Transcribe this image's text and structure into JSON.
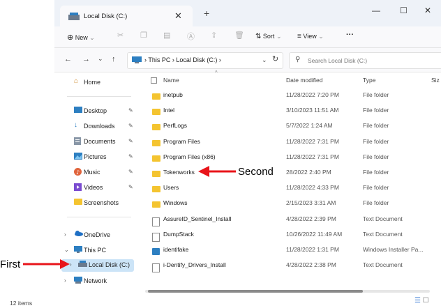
{
  "window": {
    "tab_title": "Local Disk (C:)",
    "tab_close": "✕",
    "new_tab": "+",
    "minimize": "—",
    "maximize": "☐",
    "close": "✕"
  },
  "toolbar": {
    "new_label": "New",
    "sort_label": "Sort",
    "view_label": "View",
    "more_label": "···"
  },
  "address": {
    "breadcrumb": "›  This PC  ›  Local Disk (C:)  ›",
    "search_placeholder": "Search Local Disk (C:)"
  },
  "nav_pane": {
    "home": "Home",
    "desktop": "Desktop",
    "downloads": "Downloads",
    "documents": "Documents",
    "pictures": "Pictures",
    "music": "Music",
    "videos": "Videos",
    "screenshots": "Screenshots",
    "onedrive": "OneDrive",
    "this_pc": "This PC",
    "local_disk": "Local Disk (C:)",
    "network": "Network"
  },
  "columns": {
    "name": "Name",
    "date": "Date modified",
    "type": "Type",
    "size": "Siz"
  },
  "files": [
    {
      "name": "inetpub",
      "date": "11/28/2022 7:20 PM",
      "type": "File folder",
      "icon": "folder-icon"
    },
    {
      "name": "Intel",
      "date": "3/10/2023 11:51 AM",
      "type": "File folder",
      "icon": "folder-icon"
    },
    {
      "name": "PerfLogs",
      "date": "5/7/2022 1:24 AM",
      "type": "File folder",
      "icon": "folder-icon"
    },
    {
      "name": "Program Files",
      "date": "11/28/2022 7:31 PM",
      "type": "File folder",
      "icon": "folder-icon"
    },
    {
      "name": "Program Files (x86)",
      "date": "11/28/2022 7:31 PM",
      "type": "File folder",
      "icon": "folder-icon"
    },
    {
      "name": "Tokenworks",
      "date": "28/2022 2:40 PM",
      "type": "File folder",
      "icon": "folder-icon"
    },
    {
      "name": "Users",
      "date": "11/28/2022 4:33 PM",
      "type": "File folder",
      "icon": "folder-icon"
    },
    {
      "name": "Windows",
      "date": "2/15/2023 3:31 AM",
      "type": "File folder",
      "icon": "folder-icon"
    },
    {
      "name": "AssureID_Sentinel_Install",
      "date": "4/28/2022 2:39 PM",
      "type": "Text Document",
      "icon": "document-icon"
    },
    {
      "name": "DumpStack",
      "date": "10/26/2022 11:49 AM",
      "type": "Text Document",
      "icon": "document-icon"
    },
    {
      "name": "identifake",
      "date": "11/28/2022 1:31 PM",
      "type": "Windows Installer Pa...",
      "icon": "installer-icon"
    },
    {
      "name": "i-Dentify_Drivers_Install",
      "date": "4/28/2022 2:38 PM",
      "type": "Text Document",
      "icon": "document-icon"
    }
  ],
  "status": {
    "items": "12 items"
  },
  "annotations": {
    "first": "First",
    "second": "Second"
  },
  "colors": {
    "arrow": "#e8141a",
    "selection": "#cce4f7",
    "folder": "#f4c430",
    "accent": "#1a73e8"
  }
}
